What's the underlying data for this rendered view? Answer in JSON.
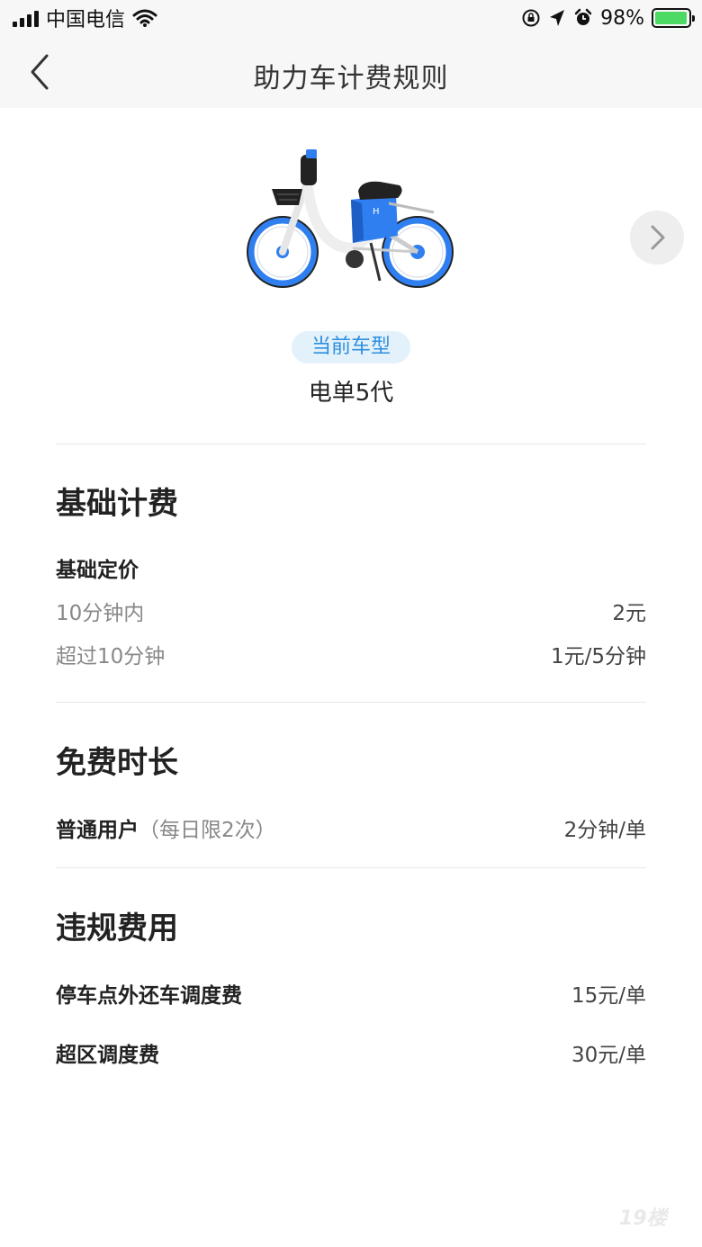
{
  "status_bar": {
    "carrier": "中国电信",
    "battery_percent": "98%",
    "battery_level": 0.98,
    "icons": [
      "signal-icon",
      "wifi-icon",
      "rotation-lock-icon",
      "location-icon",
      "alarm-icon",
      "battery-icon"
    ]
  },
  "nav": {
    "title": "助力车计费规则",
    "back_icon": "chevron-left-icon"
  },
  "vehicle": {
    "tag": "当前车型",
    "name": "电单5代",
    "next_icon": "chevron-right-icon",
    "colors": {
      "accent": "#2f7ff0",
      "frame": "#eeeeee",
      "tag_bg": "#e3f1fb",
      "tag_text": "#2e8fdf"
    }
  },
  "sections": {
    "basic": {
      "title": "基础计费",
      "subtitle": "基础定价",
      "rows": [
        {
          "label": "10分钟内",
          "value": "2元"
        },
        {
          "label": "超过10分钟",
          "value": "1元/5分钟"
        }
      ]
    },
    "free": {
      "title": "免费时长",
      "rows": [
        {
          "label": "普通用户",
          "note": "（每日限2次）",
          "value": "2分钟/单"
        }
      ]
    },
    "violation": {
      "title": "违规费用",
      "rows": [
        {
          "label": "停车点外还车调度费",
          "value": "15元/单"
        },
        {
          "label": "超区调度费",
          "value": "30元/单"
        }
      ]
    }
  },
  "watermark": "19楼"
}
